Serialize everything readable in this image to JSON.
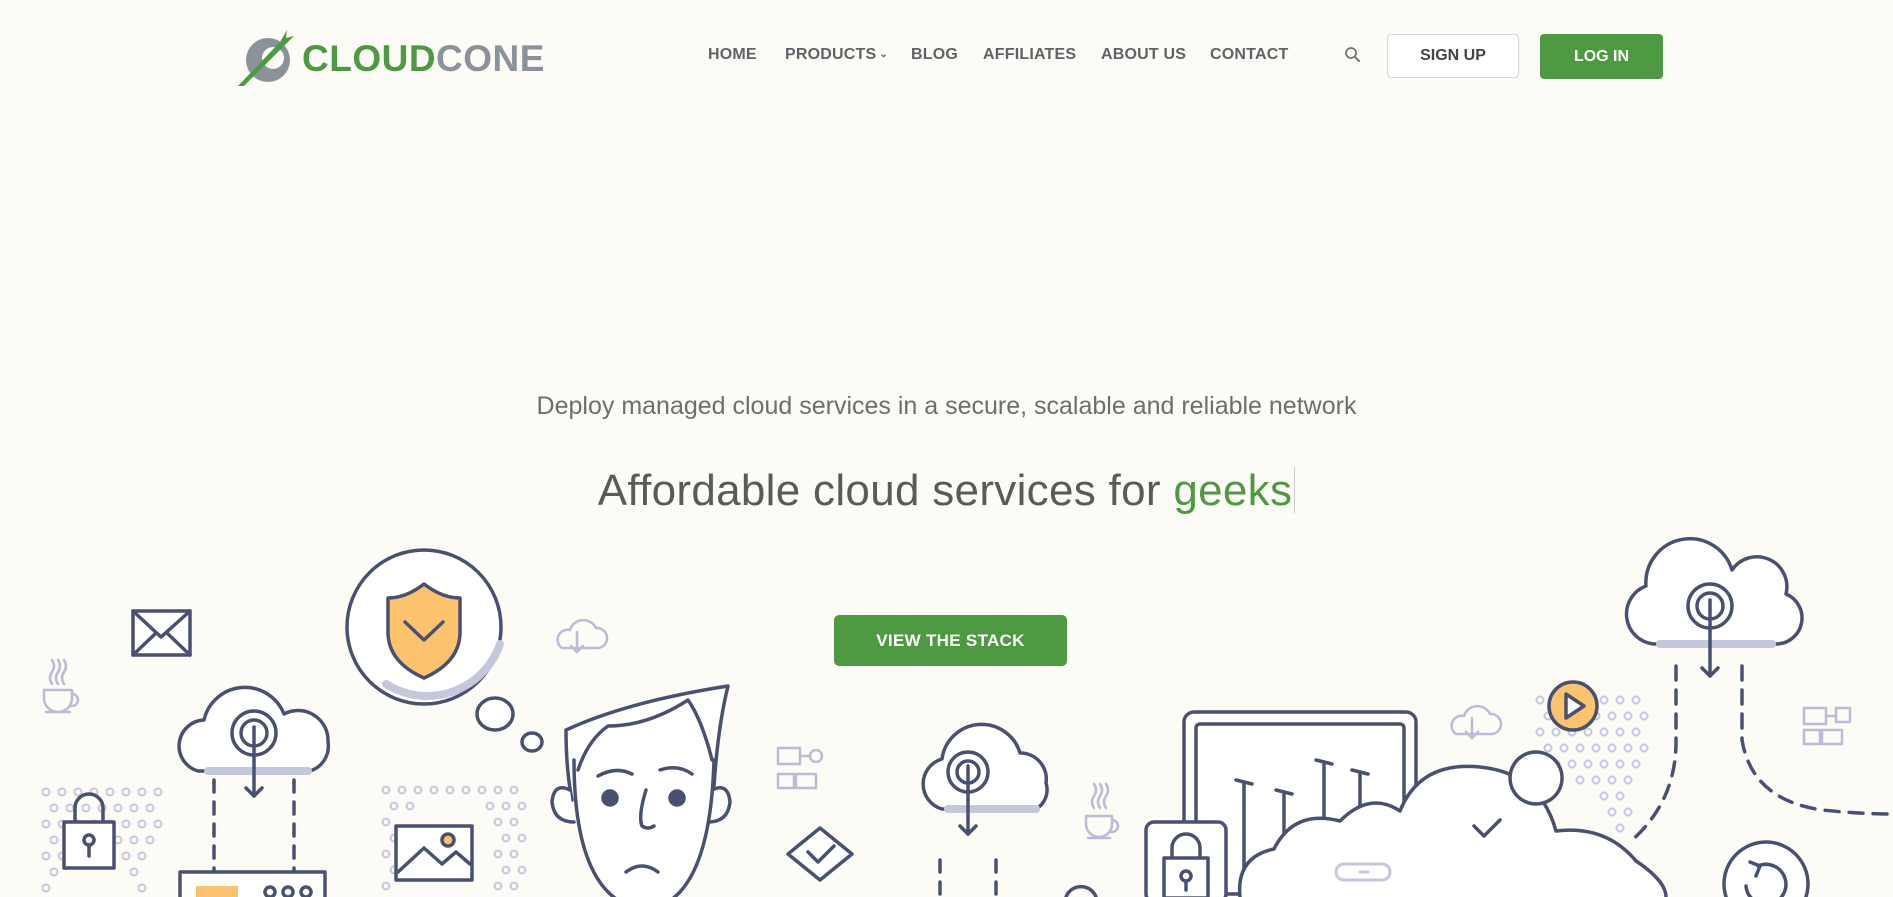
{
  "brand": {
    "name_part1": "CLOUD",
    "name_part2": "CONE"
  },
  "nav": {
    "items": [
      {
        "label": "HOME"
      },
      {
        "label": "PRODUCTS",
        "has_dropdown": true
      },
      {
        "label": "BLOG"
      },
      {
        "label": "AFFILIATES"
      },
      {
        "label": "ABOUT US"
      },
      {
        "label": "CONTACT"
      }
    ],
    "search_icon": "search-icon",
    "signup_label": "SIGN UP",
    "login_label": "LOG IN"
  },
  "hero": {
    "tagline": "Deploy managed cloud services in a secure, scalable and reliable network",
    "headline_prefix": "Affordable cloud services for ",
    "headline_highlight": "geeks",
    "cta_label": "VIEW THE STACK"
  },
  "colors": {
    "accent": "#4e9a42",
    "background": "#fdfbf5",
    "line": "#4a5170",
    "highlight_fill": "#fcc36f",
    "dot": "#c5c7dd"
  },
  "illustration_icons": [
    "mail-icon",
    "coffee-cup-icon",
    "cloud-download-icon",
    "padlock-icon",
    "shield-icon",
    "image-icon",
    "person-icon",
    "flowchart-icon",
    "diamond-check-icon",
    "dashboard-chart-icon",
    "play-icon",
    "check-icon",
    "link-icon"
  ]
}
